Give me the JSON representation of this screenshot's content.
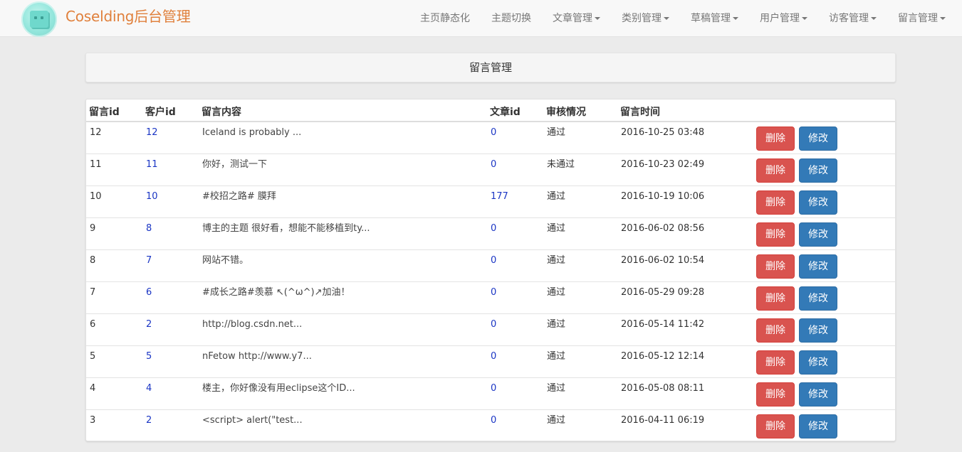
{
  "brand": {
    "title": "Coselding后台管理",
    "logo_icon": "cube-logo-icon"
  },
  "nav": [
    {
      "label": "主页静态化",
      "dropdown": false
    },
    {
      "label": "主题切换",
      "dropdown": false
    },
    {
      "label": "文章管理",
      "dropdown": true
    },
    {
      "label": "类别管理",
      "dropdown": true
    },
    {
      "label": "草稿管理",
      "dropdown": true
    },
    {
      "label": "用户管理",
      "dropdown": true
    },
    {
      "label": "访客管理",
      "dropdown": true
    },
    {
      "label": "留言管理",
      "dropdown": true
    }
  ],
  "page": {
    "header": "留言管理"
  },
  "table": {
    "columns": [
      "留言id",
      "客户id",
      "留言内容",
      "文章id",
      "审核情况",
      "留言时间",
      ""
    ],
    "delete_label": "删除",
    "edit_label": "修改",
    "rows": [
      {
        "id": "12",
        "customer_id": "12",
        "content": "Iceland is probably ...",
        "article_id": "0",
        "status": "通过",
        "time": "2016-10-25 03:48"
      },
      {
        "id": "11",
        "customer_id": "11",
        "content": "你好，测试一下",
        "article_id": "0",
        "status": "未通过",
        "time": "2016-10-23 02:49"
      },
      {
        "id": "10",
        "customer_id": "10",
        "content": "#校招之路# 膜拜",
        "article_id": "177",
        "status": "通过",
        "time": "2016-10-19 10:06"
      },
      {
        "id": "9",
        "customer_id": "8",
        "content": "博主的主题 很好看，想能不能移植到ty...",
        "article_id": "0",
        "status": "通过",
        "time": "2016-06-02 08:56"
      },
      {
        "id": "8",
        "customer_id": "7",
        "content": "网站不错。",
        "article_id": "0",
        "status": "通过",
        "time": "2016-06-02 10:54"
      },
      {
        "id": "7",
        "customer_id": "6",
        "content": "#成长之路#羡慕 ↖(^ω^)↗加油！",
        "article_id": "0",
        "status": "通过",
        "time": "2016-05-29 09:28"
      },
      {
        "id": "6",
        "customer_id": "2",
        "content": "http://blog.csdn.net...",
        "article_id": "0",
        "status": "通过",
        "time": "2016-05-14 11:42"
      },
      {
        "id": "5",
        "customer_id": "5",
        "content": "nFetow http://www.y7...",
        "article_id": "0",
        "status": "通过",
        "time": "2016-05-12 12:14"
      },
      {
        "id": "4",
        "customer_id": "4",
        "content": "楼主，你好像没有用eclipse这个ID...",
        "article_id": "0",
        "status": "通过",
        "time": "2016-05-08 08:11"
      },
      {
        "id": "3",
        "customer_id": "2",
        "content": "<script> alert(\"test...",
        "article_id": "0",
        "status": "通过",
        "time": "2016-04-11 06:19"
      }
    ]
  },
  "colors": {
    "brand": "#e0803c",
    "danger": "#d9534f",
    "primary": "#337ab7",
    "link": "#1a35c4"
  }
}
